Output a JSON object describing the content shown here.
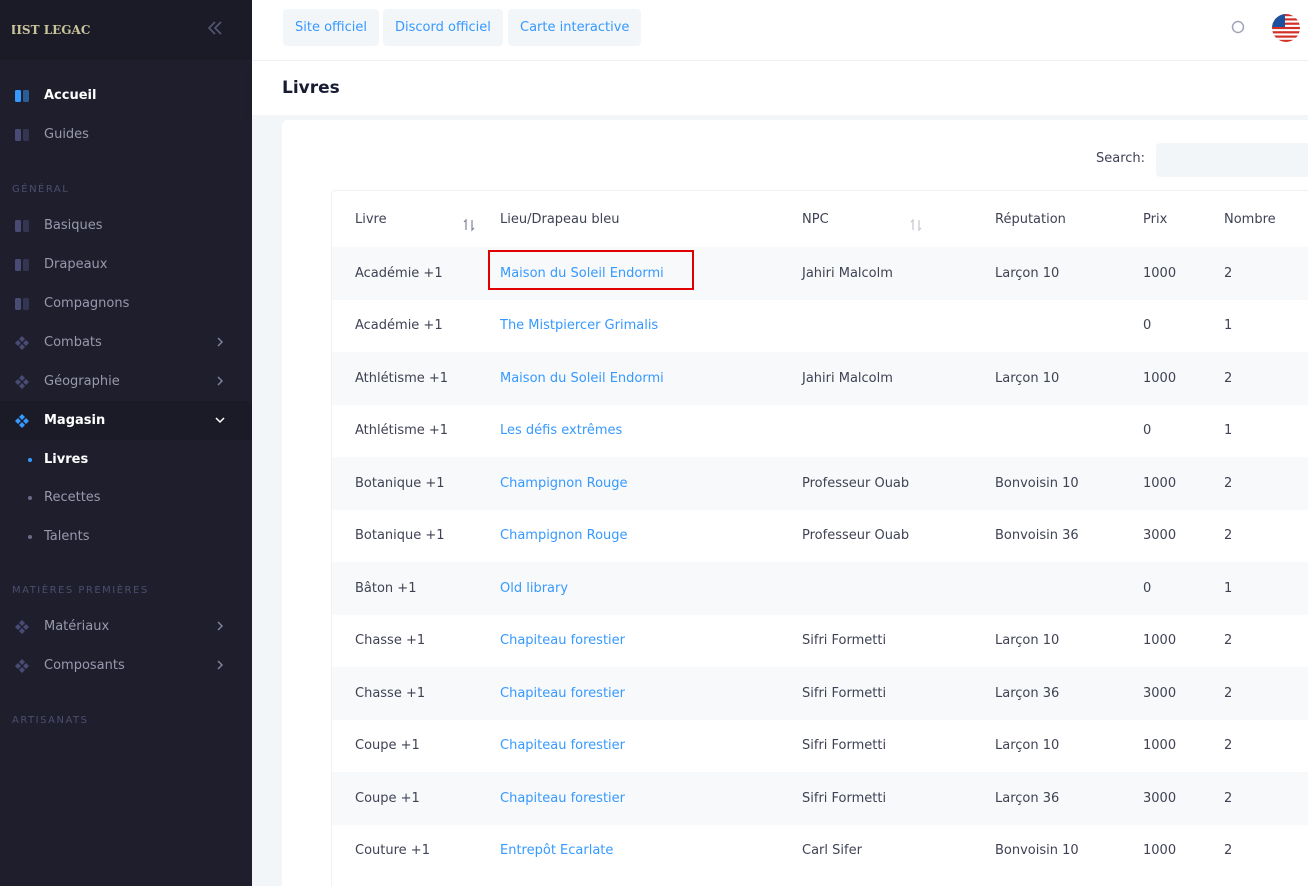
{
  "sidebar": {
    "logo_text": "MIST LEGACY",
    "top_items": [
      {
        "label": "Accueil",
        "icon": "home-icon",
        "active": true
      },
      {
        "label": "Guides",
        "icon": "book-icon",
        "active": false
      }
    ],
    "section_general": "GÉNÉRAL",
    "general_items": [
      {
        "label": "Basiques",
        "icon": "book-icon"
      },
      {
        "label": "Drapeaux",
        "icon": "book-icon"
      },
      {
        "label": "Compagnons",
        "icon": "book-icon"
      },
      {
        "label": "Combats",
        "icon": "diamond-icon",
        "has_children": true
      },
      {
        "label": "Géographie",
        "icon": "diamond-icon",
        "has_children": true
      },
      {
        "label": "Magasin",
        "icon": "diamond-icon",
        "has_children": true,
        "open": true
      }
    ],
    "magasin_sub": [
      {
        "label": "Livres",
        "active": true
      },
      {
        "label": "Recettes",
        "active": false
      },
      {
        "label": "Talents",
        "active": false
      }
    ],
    "section_matieres": "MATIÈRES PREMIÈRES",
    "matieres_items": [
      {
        "label": "Matériaux",
        "icon": "diamond-icon",
        "has_children": true
      },
      {
        "label": "Composants",
        "icon": "diamond-icon",
        "has_children": true
      }
    ],
    "section_artisanats": "ARTISANATS"
  },
  "header": {
    "links": [
      "Site officiel",
      "Discord officiel",
      "Carte interactive"
    ],
    "search_icon": "search-icon",
    "language_flag": "us-flag-icon"
  },
  "page": {
    "title": "Livres"
  },
  "table": {
    "search_label": "Search:",
    "search_value": "",
    "columns": [
      "Livre",
      "Lieu/Drapeau bleu",
      "NPC",
      "Réputation",
      "Prix",
      "Nombre"
    ],
    "rows": [
      [
        "Académie +1",
        "Maison du Soleil Endormi",
        "Jahiri Malcolm",
        "Larçon 10",
        "1000",
        "2"
      ],
      [
        "Académie +1",
        "The Mistpiercer Grimalis",
        "",
        "",
        "0",
        "1"
      ],
      [
        "Athlétisme +1",
        "Maison du Soleil Endormi",
        "Jahiri Malcolm",
        "Larçon 10",
        "1000",
        "2"
      ],
      [
        "Athlétisme +1",
        "Les défis extrêmes",
        "",
        "",
        "0",
        "1"
      ],
      [
        "Botanique +1",
        "Champignon Rouge",
        "Professeur Ouab",
        "Bonvoisin 10",
        "1000",
        "2"
      ],
      [
        "Botanique +1",
        "Champignon Rouge",
        "Professeur Ouab",
        "Bonvoisin 36",
        "3000",
        "2"
      ],
      [
        "Bâton +1",
        "Old library",
        "",
        "",
        "0",
        "1"
      ],
      [
        "Chasse +1",
        "Chapiteau forestier",
        "Sifri Formetti",
        "Larçon 10",
        "1000",
        "2"
      ],
      [
        "Chasse +1",
        "Chapiteau forestier",
        "Sifri Formetti",
        "Larçon 36",
        "3000",
        "2"
      ],
      [
        "Coupe +1",
        "Chapiteau forestier",
        "Sifri Formetti",
        "Larçon 10",
        "1000",
        "2"
      ],
      [
        "Coupe +1",
        "Chapiteau forestier",
        "Sifri Formetti",
        "Larçon 36",
        "3000",
        "2"
      ],
      [
        "Couture +1",
        "Entrepôt Ecarlate",
        "Carl Sifer",
        "Bonvoisin 10",
        "1000",
        "2"
      ]
    ]
  },
  "colors": {
    "accent": "#3699ff",
    "sidebar_bg": "#1e1e2d",
    "highlight": "#e00000"
  }
}
